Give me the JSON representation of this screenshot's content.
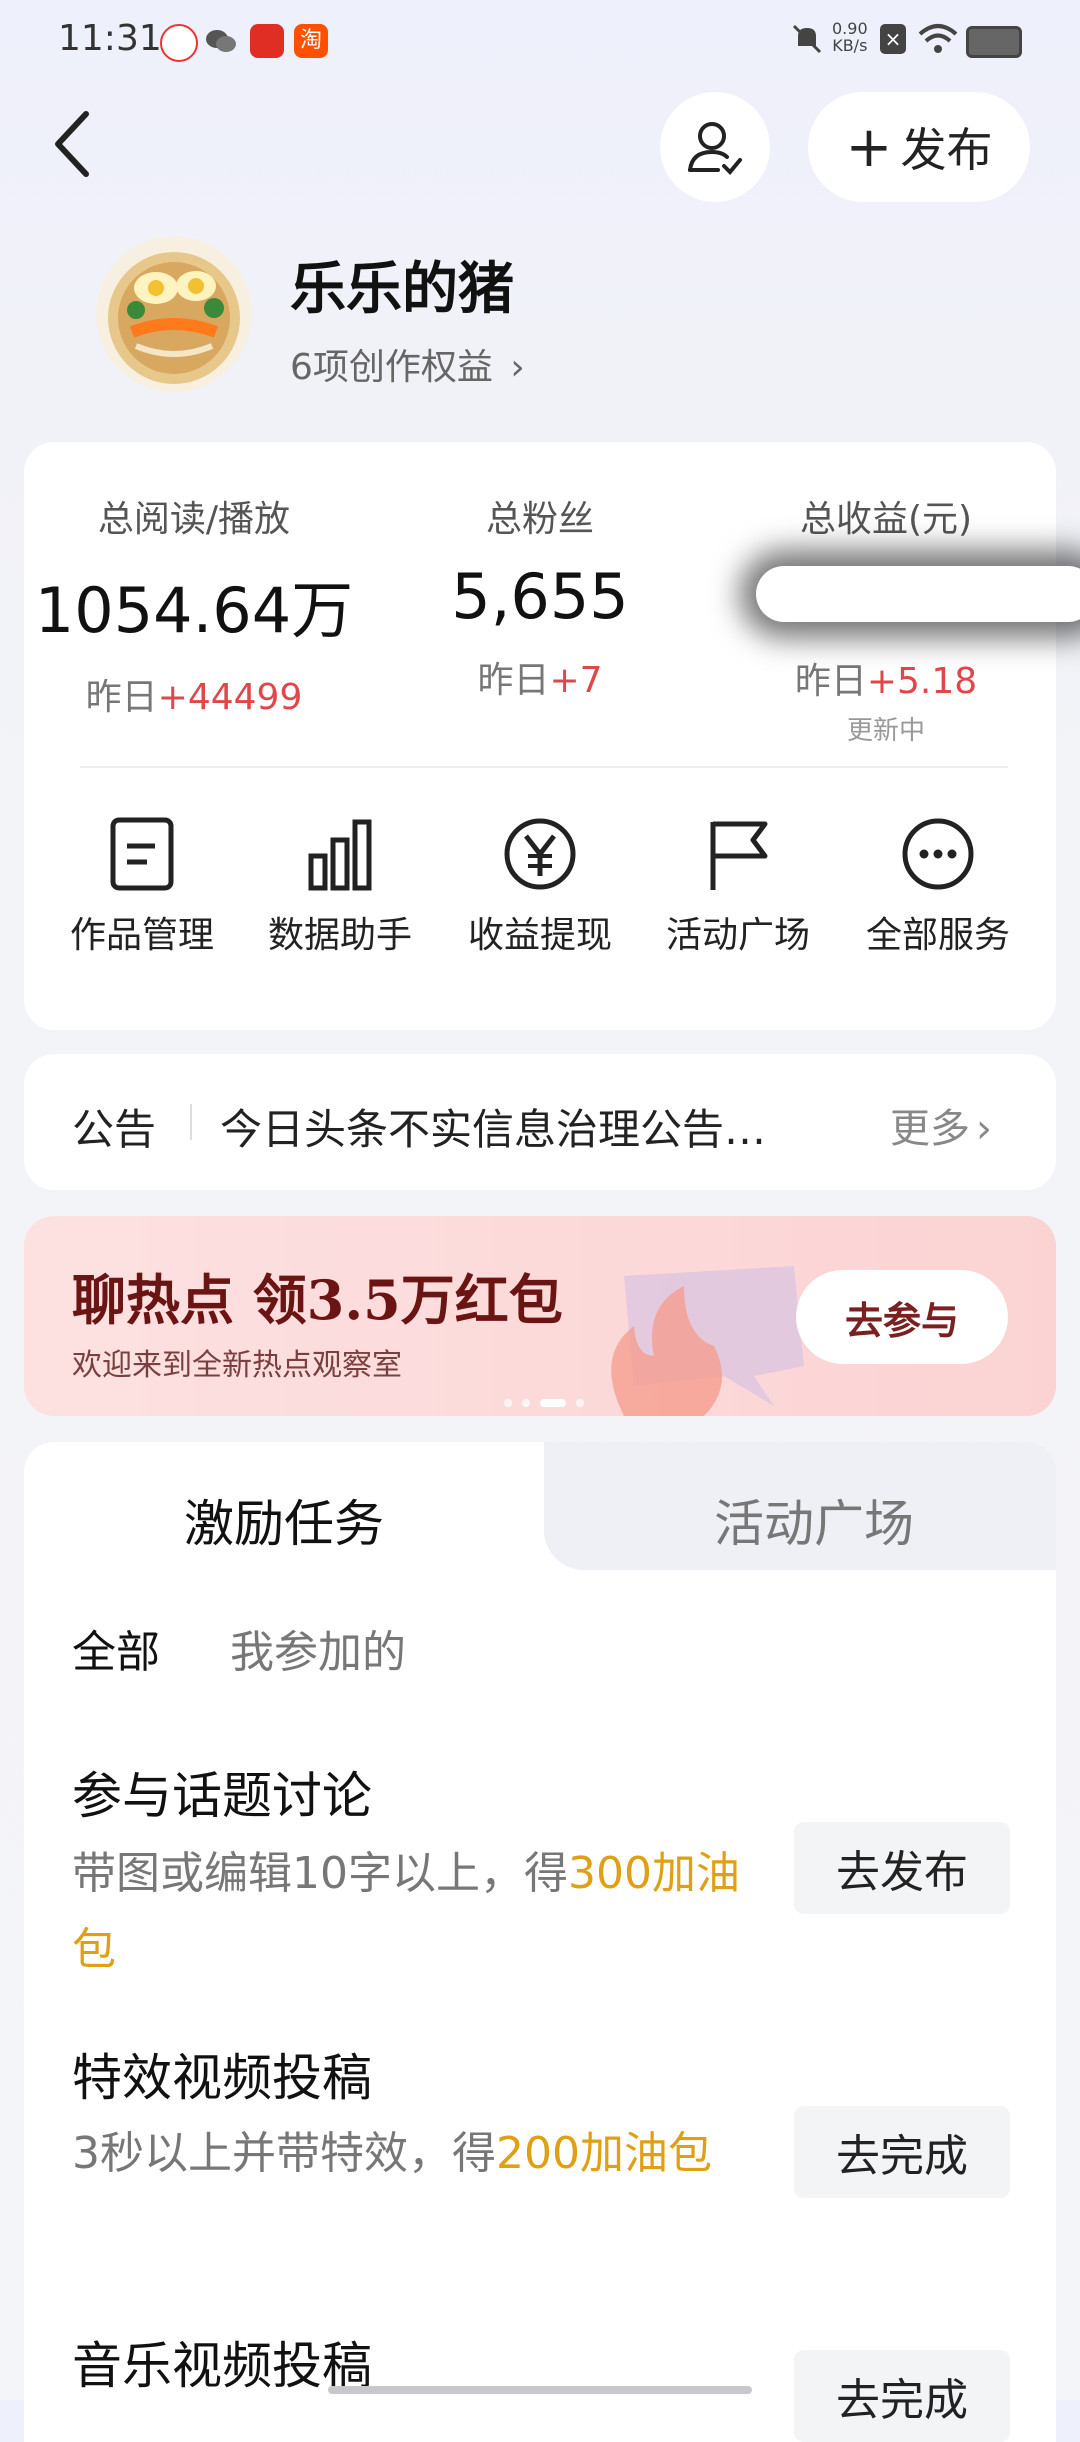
{
  "status": {
    "time": "11:31",
    "net_speed": "0.90",
    "net_unit": "KB/s",
    "icons": [
      "app-red-icon",
      "wechat-icon",
      "pinduoduo-icon",
      "taobao-icon",
      "mute-icon",
      "close-box-icon",
      "wifi-icon",
      "battery-icon"
    ]
  },
  "header": {
    "publish_label": "发布"
  },
  "profile": {
    "name": "乐乐的猪",
    "rights": "6项创作权益"
  },
  "stats": [
    {
      "label": "总阅读/播放",
      "value": "1054.64万",
      "yesterday_prefix": "昨日",
      "yesterday_delta": "+44499"
    },
    {
      "label": "总粉丝",
      "value": "5,655",
      "yesterday_prefix": "昨日",
      "yesterday_delta": "+7"
    },
    {
      "label": "总收益(元)",
      "value": "",
      "yesterday_prefix": "昨日",
      "yesterday_delta": "+5.18",
      "note": "更新中"
    }
  ],
  "services": [
    {
      "label": "作品管理",
      "icon": "document-icon"
    },
    {
      "label": "数据助手",
      "icon": "bar-chart-icon"
    },
    {
      "label": "收益提现",
      "icon": "yuan-icon"
    },
    {
      "label": "活动广场",
      "icon": "flag-icon"
    },
    {
      "label": "全部服务",
      "icon": "more-icon"
    }
  ],
  "notice": {
    "label": "公告",
    "text": "今日头条不实信息治理公告…",
    "more": "更多"
  },
  "banner": {
    "title": "聊热点 领3.5万红包",
    "subtitle": "欢迎来到全新热点观察室",
    "cta": "去参与"
  },
  "tasks": {
    "tabs": [
      "激励任务",
      "活动广场"
    ],
    "filters": [
      "全部",
      "我参加的"
    ],
    "items": [
      {
        "title": "参与话题讨论",
        "desc_pre": "带图或编辑10字以上，得",
        "desc_hl": "300加油包",
        "btn": "去发布"
      },
      {
        "title": "特效视频投稿",
        "desc_pre": "3秒以上并带特效，得",
        "desc_hl": "200加油包",
        "btn": "去完成"
      },
      {
        "title": "音乐视频投稿",
        "desc_pre": "",
        "desc_hl": "",
        "btn": "去完成"
      }
    ]
  },
  "colors": {
    "accent_red": "#e0474a",
    "accent_orange": "#e0a016",
    "banner_bg": "#fde1e1"
  }
}
